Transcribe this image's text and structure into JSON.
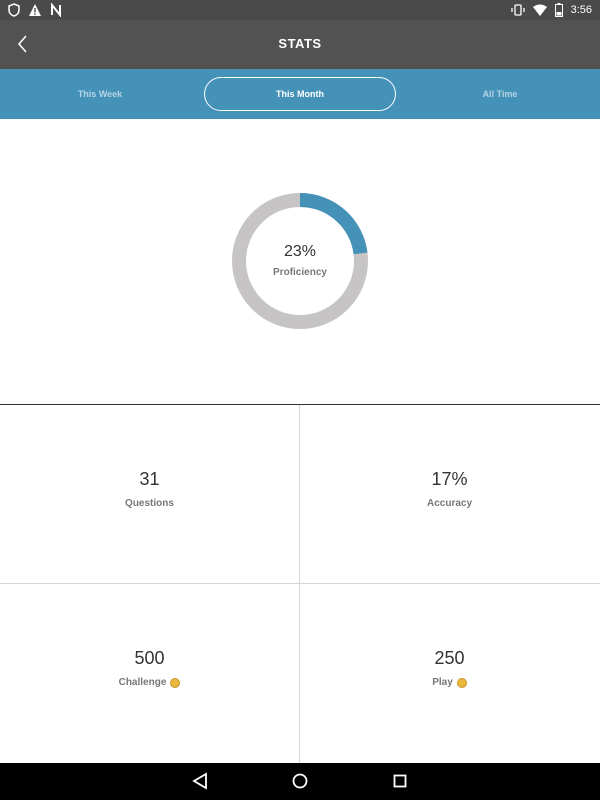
{
  "status_bar": {
    "time": "3:56",
    "battery_level": "2",
    "icons_left": [
      "shield-icon",
      "warning-icon",
      "notification-n-icon"
    ],
    "icons_right": [
      "vibrate-icon",
      "wifi-icon",
      "battery-icon"
    ]
  },
  "app_bar": {
    "title": "STATS"
  },
  "tabs": [
    {
      "label": "This Week",
      "selected": false
    },
    {
      "label": "This Month",
      "selected": true
    },
    {
      "label": "All Time",
      "selected": false
    }
  ],
  "proficiency": {
    "value_text": "23%",
    "value": 0.23,
    "label": "Proficiency"
  },
  "stats": {
    "questions": {
      "value": "31",
      "label": "Questions"
    },
    "accuracy": {
      "value": "17%",
      "label": "Accuracy"
    },
    "challenge": {
      "value": "500",
      "label": "Challenge"
    },
    "play": {
      "value": "250",
      "label": "Play"
    }
  },
  "colors": {
    "accent": "#4592b9",
    "app_bar": "#525252",
    "ring_track": "#c6c4c5",
    "coin": "#e9b73b"
  }
}
